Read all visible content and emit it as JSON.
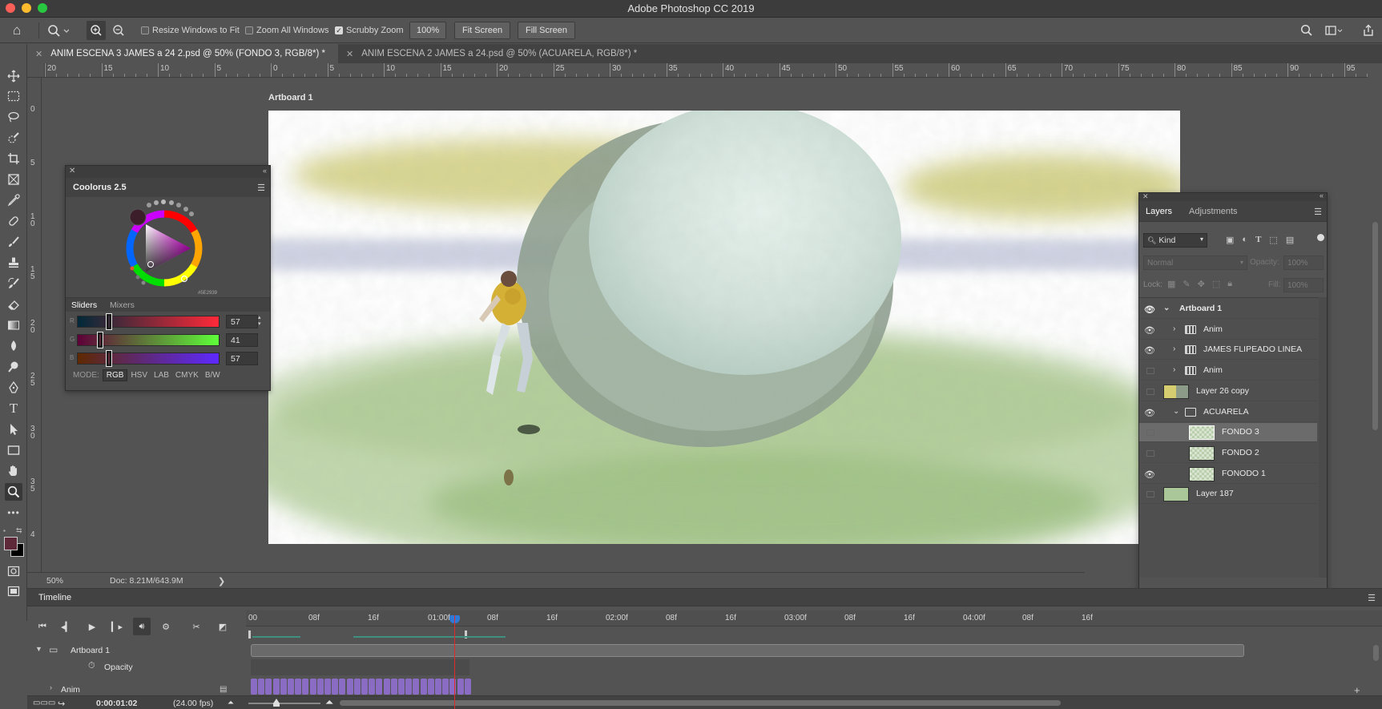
{
  "window": {
    "title": "Adobe Photoshop CC 2019"
  },
  "options": {
    "resize_windows": "Resize Windows to Fit",
    "zoom_all": "Zoom All Windows",
    "scrubby": "Scrubby Zoom",
    "zoom_value": "100%",
    "fit_screen": "Fit Screen",
    "fill_screen": "Fill Screen"
  },
  "tabs": [
    {
      "label": "ANIM ESCENA 3 JAMES a 24 2.psd @ 50% (FONDO 3, RGB/8*) *",
      "active": true
    },
    {
      "label": "ANIM ESCENA 2 JAMES a 24.psd @ 50% (ACUARELA, RGB/8*) *",
      "active": false
    }
  ],
  "ruler_top": [
    "20",
    "15",
    "10",
    "5",
    "0",
    "5",
    "10",
    "15",
    "20",
    "25",
    "30",
    "35",
    "40",
    "45",
    "50",
    "55",
    "60",
    "65",
    "70",
    "75",
    "80",
    "85",
    "90",
    "95"
  ],
  "ruler_left": [
    "0",
    "5",
    "1 0",
    "1 5",
    "2 0",
    "2 5",
    "3 0",
    "3 5",
    "4"
  ],
  "artboard_label": "Artboard 1",
  "status": {
    "zoom": "50%",
    "doc": "Doc: 8.21M/643.9M"
  },
  "coolorus": {
    "title": "Coolorus 2.5",
    "tab_sliders": "Sliders",
    "tab_mixers": "Mixers",
    "swatch_code": "#5E2939",
    "sliders": [
      {
        "ch": "R",
        "value": "57",
        "pos": 0.22
      },
      {
        "ch": "G",
        "value": "41",
        "pos": 0.16
      },
      {
        "ch": "B",
        "value": "57",
        "pos": 0.22
      }
    ],
    "mode_label": "MODE:",
    "modes": [
      "RGB",
      "HSV",
      "LAB",
      "CMYK",
      "B/W"
    ]
  },
  "layers": {
    "tab_layers": "Layers",
    "tab_adjust": "Adjustments",
    "kind": "Kind",
    "blend": "Normal",
    "opacity_label": "Opacity:",
    "opacity_value": "100%",
    "lock_label": "Lock:",
    "fill_label": "Fill:",
    "fill_value": "100%",
    "rows": [
      {
        "name": "Artboard 1",
        "indent": 0,
        "eye": true,
        "type": "artboard"
      },
      {
        "name": "Anim",
        "indent": 1,
        "eye": true,
        "type": "anim"
      },
      {
        "name": "JAMES FLIPEADO LINEA",
        "indent": 1,
        "eye": true,
        "type": "anim"
      },
      {
        "name": "Anim",
        "indent": 1,
        "eye": false,
        "type": "anim"
      },
      {
        "name": "Layer 26 copy",
        "indent": 1,
        "eye": false,
        "type": "smart"
      },
      {
        "name": "ACUARELA",
        "indent": 1,
        "eye": true,
        "type": "group"
      },
      {
        "name": "FONDO 3",
        "indent": 2,
        "eye": false,
        "type": "pixel",
        "selected": true
      },
      {
        "name": "FONDO 2",
        "indent": 2,
        "eye": false,
        "type": "pixel"
      },
      {
        "name": "FONODO 1",
        "indent": 2,
        "eye": true,
        "type": "pixel"
      },
      {
        "name": "Layer 187",
        "indent": 1,
        "eye": false,
        "type": "solid"
      }
    ]
  },
  "timeline": {
    "title": "Timeline",
    "ticks": [
      "00",
      "08f",
      "16f",
      "01:00f",
      "08f",
      "16f",
      "02:00f",
      "08f",
      "16f",
      "03:00f",
      "08f",
      "16f",
      "04:00f",
      "08f",
      "16f"
    ],
    "track_artboard": "Artboard 1",
    "track_opacity": "Opacity",
    "track_anim": "Anim",
    "timecode": "0:00:01:02",
    "fps": "(24.00 fps)"
  },
  "colors": {
    "fg": "#5e2939",
    "bg": "#000000",
    "playhead": "#e02a2a",
    "anim_frames": "#8a6cc4"
  }
}
